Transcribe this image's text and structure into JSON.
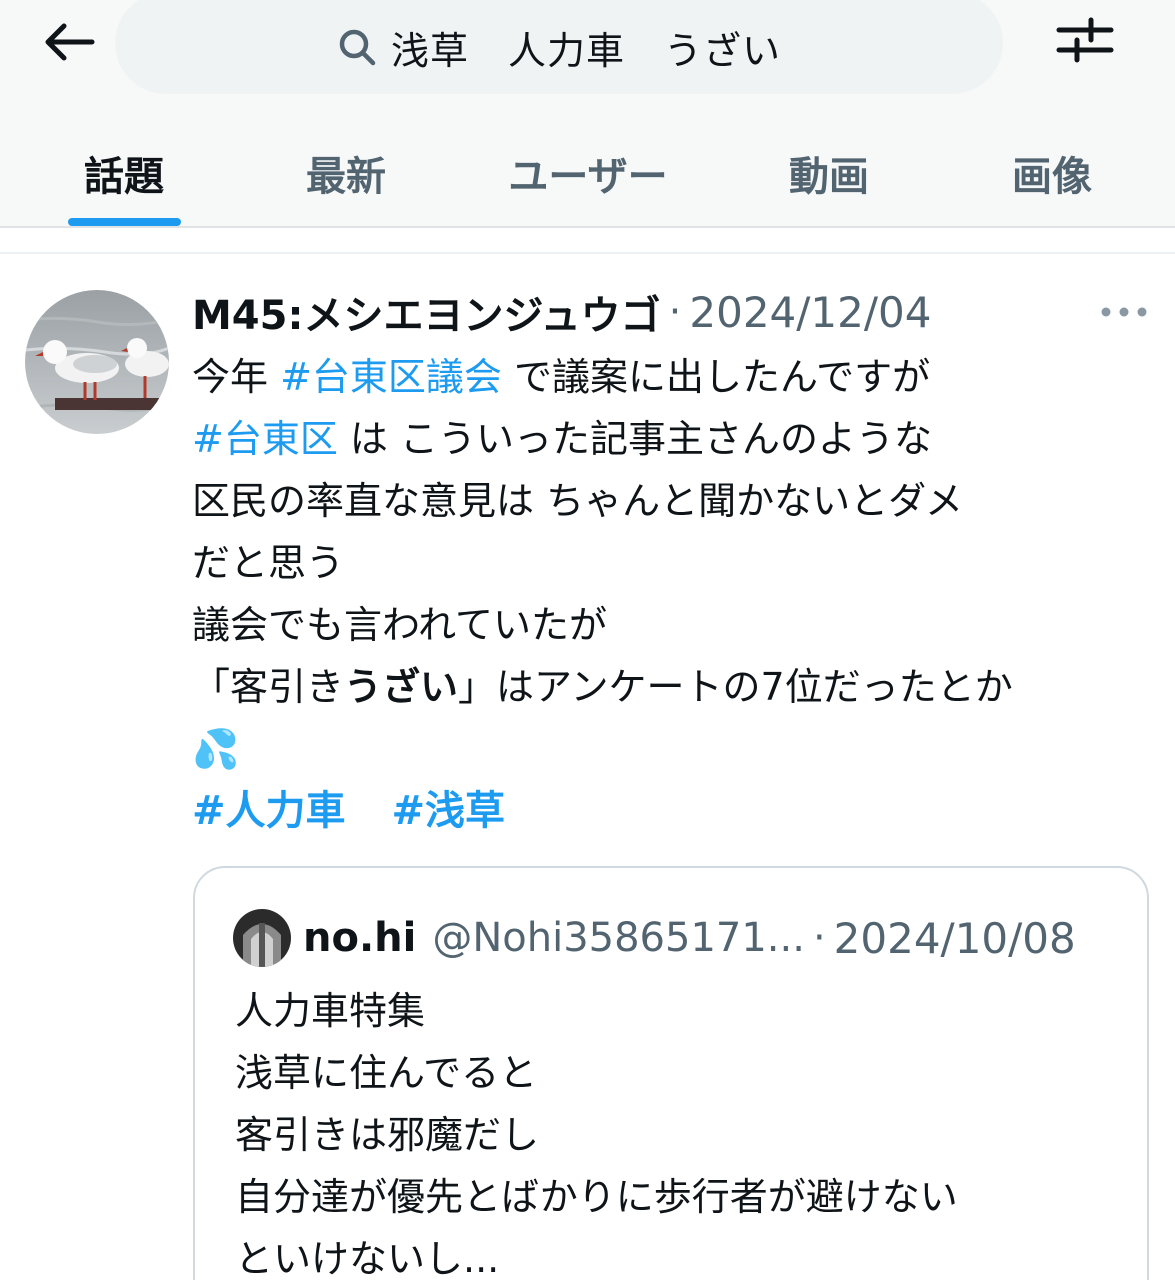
{
  "header": {
    "search_query": "浅草　人力車　うざい",
    "tabs": [
      {
        "label": "話題",
        "active": true
      },
      {
        "label": "最新",
        "active": false
      },
      {
        "label": "ユーザー",
        "active": false
      },
      {
        "label": "動画",
        "active": false
      },
      {
        "label": "画像",
        "active": false
      }
    ],
    "icons": {
      "back": "arrow-left-icon",
      "search": "search-icon",
      "filter": "filter-sliders-icon"
    }
  },
  "colors": {
    "accent": "#1d9bf0",
    "text": "#0f1419",
    "muted": "#536471",
    "border": "#cfd9de"
  },
  "tweet": {
    "author": "M45:メシエヨンジュウゴ",
    "separator": "·",
    "date": "2024/12/04",
    "lines": [
      {
        "t1": "今年 ",
        "tag": "#台東区議会",
        "t2": " で議案に出したんですが"
      },
      {
        "tag": "#台東区",
        "t2": " は こういった記事主さんのような"
      },
      {
        "t1": "区民の率直な意見は ちゃんと聞かないとダメ"
      },
      {
        "t1": "だと思う"
      },
      {
        "t1": "議会でも言われていたが"
      },
      {
        "t1": "「客引き",
        "bold": "うざい",
        "t2": "」はアンケートの7位だったとか"
      },
      {
        "emoji": "💦"
      }
    ],
    "hashtags": [
      "#人力車",
      "#浅草"
    ]
  },
  "quoted_tweet": {
    "name": "no.hi",
    "handle": "@Nohi35865171...",
    "separator": "·",
    "date": "2024/10/08",
    "lines": [
      "人力車特集",
      "浅草に住んでると",
      "客引きは邪魔だし",
      "自分達が優先とばかりに歩行者が避けない",
      "といけないし..."
    ]
  }
}
